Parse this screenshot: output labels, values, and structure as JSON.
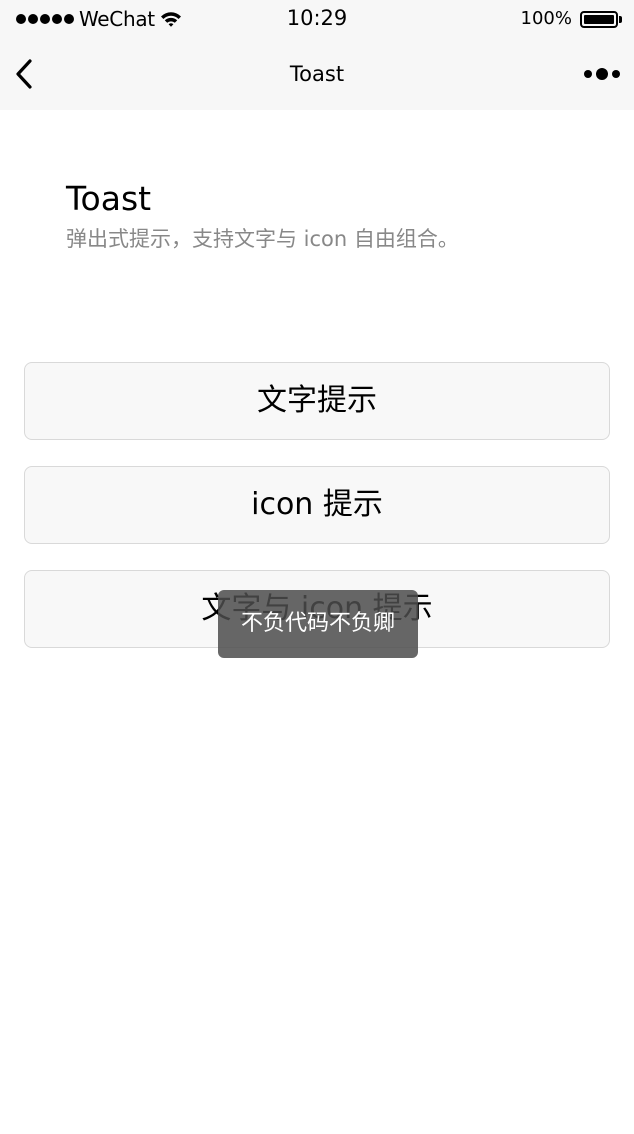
{
  "status_bar": {
    "carrier": "WeChat",
    "time": "10:29",
    "battery_text": "100%",
    "battery_level": 1.0
  },
  "nav": {
    "title": "Toast",
    "back_icon": "chevron-left-icon",
    "more_icon": "more-dots-icon"
  },
  "header": {
    "title": "Toast",
    "description": "弹出式提示，支持文字与 icon 自由组合。"
  },
  "buttons": [
    {
      "label": "文字提示"
    },
    {
      "label": "icon 提示"
    },
    {
      "label": "文字与 icon 提示"
    }
  ],
  "toast": {
    "text": "不负代码不负卿"
  }
}
